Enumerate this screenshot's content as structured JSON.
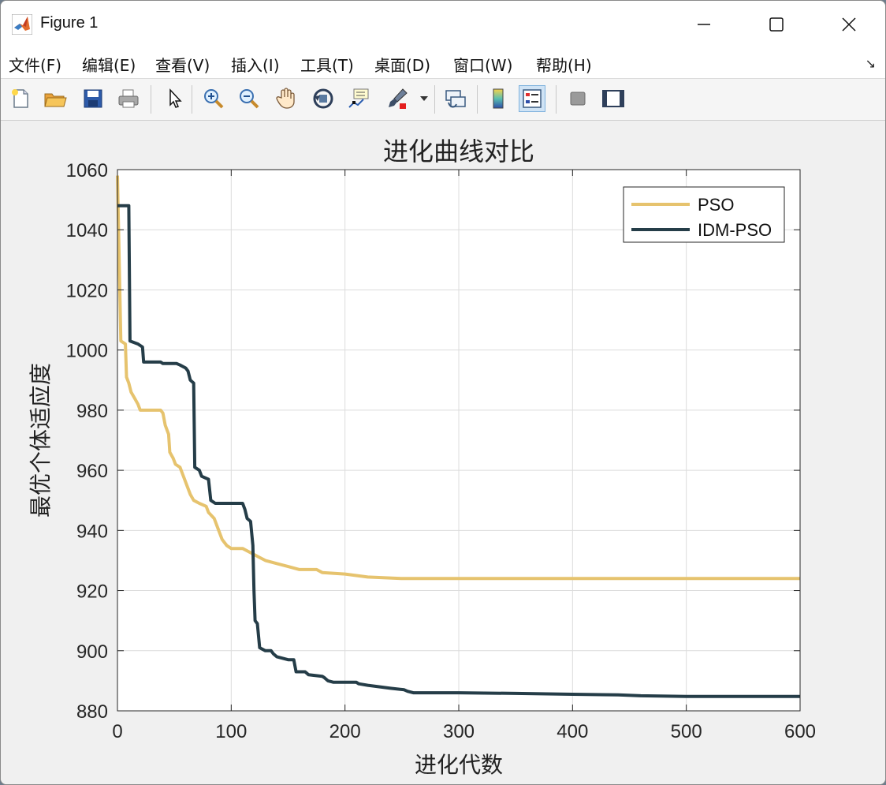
{
  "window": {
    "title": "Figure 1",
    "minimize_label": "—",
    "maximize_label": "☐",
    "close_label": "✕"
  },
  "menu": {
    "items": [
      "文件(F)",
      "编辑(E)",
      "查看(V)",
      "插入(I)",
      "工具(T)",
      "桌面(D)",
      "窗口(W)",
      "帮助(H)"
    ],
    "overflow": "↘"
  },
  "toolbar": {
    "buttons": [
      "new-figure-icon",
      "open-file-icon",
      "save-icon",
      "print-icon",
      "pointer-icon",
      "zoom-in-icon",
      "zoom-out-icon",
      "pan-hand-icon",
      "rotate-3d-icon",
      "data-cursor-icon",
      "brush-icon",
      "link-plot-icon",
      "colorbar-icon",
      "legend-icon",
      "hide-plot-tools-icon",
      "show-plot-tools-icon"
    ]
  },
  "chart_data": {
    "type": "line",
    "title": "进化曲线对比",
    "xlabel": "进化代数",
    "ylabel": "最优个体适应度",
    "xlim": [
      0,
      600
    ],
    "ylim": [
      880,
      1060
    ],
    "xticks": [
      0,
      100,
      200,
      300,
      400,
      500,
      600
    ],
    "yticks": [
      880,
      900,
      920,
      940,
      960,
      980,
      1000,
      1020,
      1040,
      1060
    ],
    "grid": true,
    "legend_position": "top-right",
    "series": [
      {
        "name": "PSO",
        "color": "#e6c36e",
        "points": [
          [
            0,
            1058
          ],
          [
            3,
            1003
          ],
          [
            7,
            1002
          ],
          [
            8,
            991
          ],
          [
            10,
            989
          ],
          [
            12,
            986
          ],
          [
            15,
            984
          ],
          [
            18,
            982
          ],
          [
            20,
            980
          ],
          [
            28,
            980
          ],
          [
            38,
            980
          ],
          [
            40,
            979
          ],
          [
            42,
            975
          ],
          [
            45,
            972
          ],
          [
            46,
            966
          ],
          [
            49,
            964
          ],
          [
            51,
            962
          ],
          [
            55,
            961
          ],
          [
            58,
            958
          ],
          [
            62,
            954
          ],
          [
            64,
            952
          ],
          [
            67,
            950
          ],
          [
            72,
            949
          ],
          [
            78,
            948
          ],
          [
            80,
            946
          ],
          [
            85,
            944
          ],
          [
            88,
            941
          ],
          [
            92,
            937
          ],
          [
            96,
            935
          ],
          [
            100,
            934
          ],
          [
            110,
            934
          ],
          [
            115,
            933
          ],
          [
            125,
            931
          ],
          [
            130,
            930
          ],
          [
            140,
            929
          ],
          [
            150,
            928
          ],
          [
            160,
            927
          ],
          [
            175,
            927
          ],
          [
            180,
            926
          ],
          [
            200,
            925.5
          ],
          [
            210,
            925
          ],
          [
            220,
            924.5
          ],
          [
            250,
            924
          ],
          [
            300,
            924
          ],
          [
            400,
            924
          ],
          [
            600,
            924
          ]
        ]
      },
      {
        "name": "IDM-PSO",
        "color": "#253d48",
        "points": [
          [
            0,
            1048
          ],
          [
            10,
            1048
          ],
          [
            11,
            1003
          ],
          [
            18,
            1002
          ],
          [
            22,
            1001
          ],
          [
            23,
            996
          ],
          [
            38,
            996
          ],
          [
            40,
            995.5
          ],
          [
            52,
            995.5
          ],
          [
            55,
            995
          ],
          [
            60,
            994
          ],
          [
            62,
            993
          ],
          [
            64,
            990
          ],
          [
            67,
            989
          ],
          [
            68,
            961
          ],
          [
            72,
            960
          ],
          [
            74,
            958
          ],
          [
            80,
            957
          ],
          [
            82,
            950
          ],
          [
            86,
            949
          ],
          [
            110,
            949
          ],
          [
            112,
            947
          ],
          [
            114,
            944
          ],
          [
            117,
            943
          ],
          [
            119,
            935
          ],
          [
            120,
            920
          ],
          [
            121,
            910
          ],
          [
            123,
            909
          ],
          [
            125,
            901
          ],
          [
            130,
            900
          ],
          [
            135,
            900
          ],
          [
            137,
            899
          ],
          [
            140,
            898
          ],
          [
            150,
            897
          ],
          [
            155,
            897
          ],
          [
            157,
            893
          ],
          [
            165,
            893
          ],
          [
            168,
            892
          ],
          [
            180,
            891.5
          ],
          [
            182,
            891
          ],
          [
            185,
            890
          ],
          [
            190,
            889.5
          ],
          [
            210,
            889.5
          ],
          [
            212,
            889
          ],
          [
            220,
            888.5
          ],
          [
            230,
            888
          ],
          [
            240,
            887.5
          ],
          [
            252,
            887
          ],
          [
            255,
            886.5
          ],
          [
            260,
            886
          ],
          [
            300,
            886
          ],
          [
            350,
            885.8
          ],
          [
            400,
            885.5
          ],
          [
            440,
            885.3
          ],
          [
            460,
            885
          ],
          [
            500,
            884.8
          ],
          [
            600,
            884.8
          ]
        ]
      }
    ]
  }
}
